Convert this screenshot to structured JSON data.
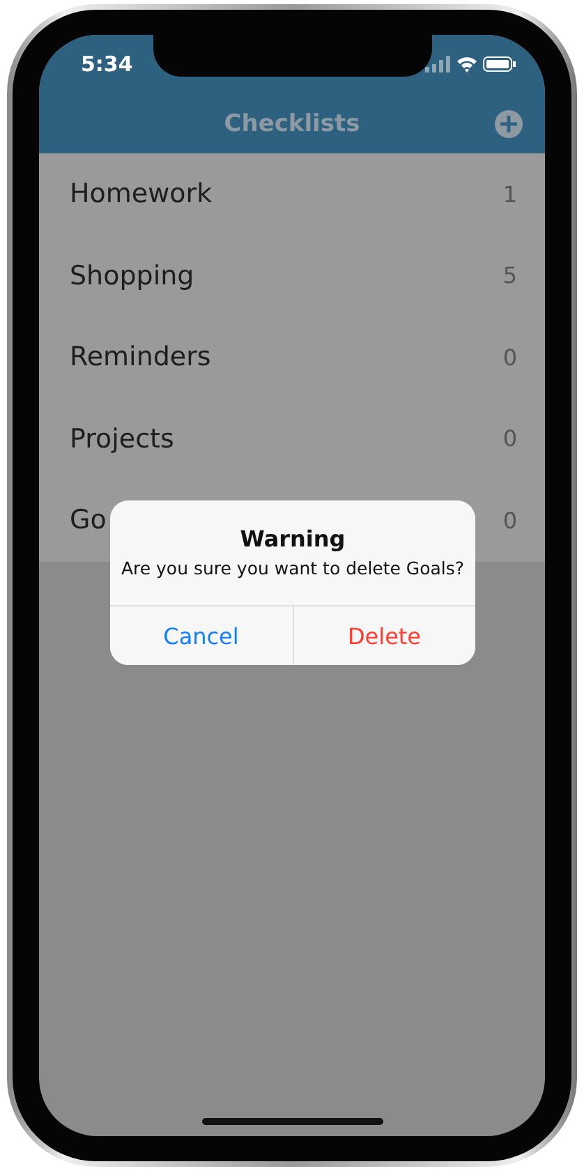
{
  "status_bar": {
    "time": "5:34"
  },
  "nav": {
    "title": "Checklists"
  },
  "lists": [
    {
      "name": "Homework",
      "count": "1"
    },
    {
      "name": "Shopping",
      "count": "5"
    },
    {
      "name": "Reminders",
      "count": "0"
    },
    {
      "name": "Projects",
      "count": "0"
    },
    {
      "name": "Go",
      "count": "0"
    }
  ],
  "alert": {
    "title": "Warning",
    "message": "Are you sure you want to delete Goals?",
    "buttons": [
      {
        "label": "Cancel",
        "kind": "cancel"
      },
      {
        "label": "Delete",
        "kind": "destructive"
      }
    ]
  }
}
